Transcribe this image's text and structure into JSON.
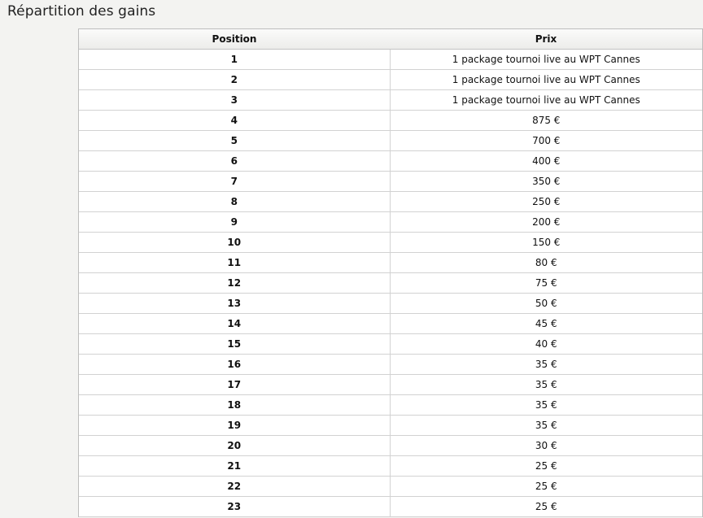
{
  "title": "Répartition des gains",
  "table": {
    "headers": {
      "position": "Position",
      "prize": "Prix"
    },
    "rows": [
      {
        "position": "1",
        "prize": "1 package tournoi live au WPT Cannes"
      },
      {
        "position": "2",
        "prize": "1 package tournoi live au WPT Cannes"
      },
      {
        "position": "3",
        "prize": "1 package tournoi live au WPT Cannes"
      },
      {
        "position": "4",
        "prize": "875 €"
      },
      {
        "position": "5",
        "prize": "700 €"
      },
      {
        "position": "6",
        "prize": "400 €"
      },
      {
        "position": "7",
        "prize": "350 €"
      },
      {
        "position": "8",
        "prize": "250 €"
      },
      {
        "position": "9",
        "prize": "200 €"
      },
      {
        "position": "10",
        "prize": "150 €"
      },
      {
        "position": "11",
        "prize": "80 €"
      },
      {
        "position": "12",
        "prize": "75 €"
      },
      {
        "position": "13",
        "prize": "50 €"
      },
      {
        "position": "14",
        "prize": "45 €"
      },
      {
        "position": "15",
        "prize": "40 €"
      },
      {
        "position": "16",
        "prize": "35 €"
      },
      {
        "position": "17",
        "prize": "35 €"
      },
      {
        "position": "18",
        "prize": "35 €"
      },
      {
        "position": "19",
        "prize": "35 €"
      },
      {
        "position": "20",
        "prize": "30 €"
      },
      {
        "position": "21",
        "prize": "25 €"
      },
      {
        "position": "22",
        "prize": "25 €"
      },
      {
        "position": "23",
        "prize": "25 €"
      }
    ]
  }
}
